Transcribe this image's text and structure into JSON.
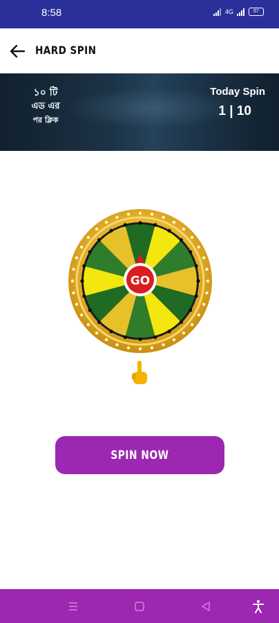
{
  "status_bar": {
    "time": "8:58",
    "network_label": "4G",
    "battery": "67"
  },
  "app_bar": {
    "title": "HARD SPIN"
  },
  "header": {
    "ad_line1": "১০ টি",
    "ad_line2": "এড এর",
    "ad_line3": "পর ক্লিক",
    "today_label": "Today Spin",
    "today_count": "1 | 10"
  },
  "wheel": {
    "center_label": "GO",
    "segment_colors": [
      "#1f6b24",
      "#f3e70f",
      "#2f7d2a",
      "#e6c12a"
    ],
    "rim_color": "#e8b92a"
  },
  "spin_button": {
    "label": "SPIN NOW"
  },
  "colors": {
    "status_bar": "#2b2f9a",
    "accent": "#9c27b0",
    "header_bg": "#162a3b"
  },
  "nav_bar": {
    "icons": [
      "menu-icon",
      "home-square-icon",
      "back-triangle-icon",
      "accessibility-icon"
    ]
  }
}
